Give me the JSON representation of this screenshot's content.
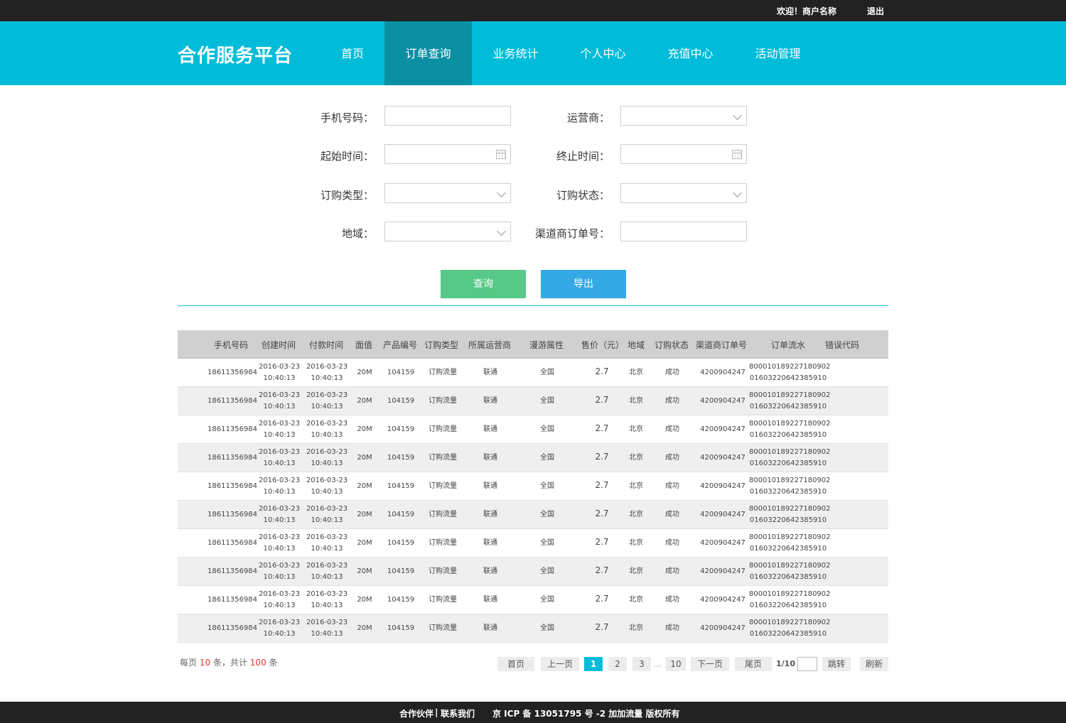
{
  "topbar": {
    "welcome": "欢迎！商户名称",
    "logout": "退出"
  },
  "header": {
    "brand": "合作服务平台",
    "nav": [
      {
        "label": "首页",
        "active": false
      },
      {
        "label": "订单查询",
        "active": true
      },
      {
        "label": "业务统计",
        "active": false
      },
      {
        "label": "个人中心",
        "active": false
      },
      {
        "label": "充值中心",
        "active": false
      },
      {
        "label": "活动管理",
        "active": false
      }
    ]
  },
  "form": {
    "phone_label": "手机号码：",
    "carrier_label": "运营商：",
    "start_label": "起始时间：",
    "end_label": "终止时间：",
    "order_type_label": "订购类型：",
    "order_status_label": "订购状态：",
    "region_label": "地域：",
    "channel_order_label": "渠道商订单号："
  },
  "actions": {
    "query": "查询",
    "export": "导出"
  },
  "table": {
    "headers": [
      "手机号码",
      "创建时间",
      "付款时间",
      "面值",
      "产品编号",
      "订购类型",
      "所属运营商",
      "漫游属性",
      "售价（元）",
      "地域",
      "订购状态",
      "渠道商订单号",
      "订单流水",
      "错误代码"
    ],
    "rows": [
      {
        "phone": "18611356984",
        "created_date": "2016-03-23",
        "created_time": "10:40:13",
        "paid_date": "2016-03-23",
        "paid_time": "10:40:13",
        "face": "20M",
        "product": "104159",
        "type": "订购流量",
        "carrier": "联通",
        "roam": "全国",
        "price": "2.7",
        "region": "北京",
        "status": "成功",
        "channel_order": "4200904247",
        "serial_1": "800010189227180902",
        "serial_2": "01603220642385910",
        "error": ""
      },
      {
        "phone": "18611356984",
        "created_date": "2016-03-23",
        "created_time": "10:40:13",
        "paid_date": "2016-03-23",
        "paid_time": "10:40:13",
        "face": "20M",
        "product": "104159",
        "type": "订购流量",
        "carrier": "联通",
        "roam": "全国",
        "price": "2.7",
        "region": "北京",
        "status": "成功",
        "channel_order": "4200904247",
        "serial_1": "800010189227180902",
        "serial_2": "01603220642385910",
        "error": ""
      },
      {
        "phone": "18611356984",
        "created_date": "2016-03-23",
        "created_time": "10:40:13",
        "paid_date": "2016-03-23",
        "paid_time": "10:40:13",
        "face": "20M",
        "product": "104159",
        "type": "订购流量",
        "carrier": "联通",
        "roam": "全国",
        "price": "2.7",
        "region": "北京",
        "status": "成功",
        "channel_order": "4200904247",
        "serial_1": "800010189227180902",
        "serial_2": "01603220642385910",
        "error": ""
      },
      {
        "phone": "18611356984",
        "created_date": "2016-03-23",
        "created_time": "10:40:13",
        "paid_date": "2016-03-23",
        "paid_time": "10:40:13",
        "face": "20M",
        "product": "104159",
        "type": "订购流量",
        "carrier": "联通",
        "roam": "全国",
        "price": "2.7",
        "region": "北京",
        "status": "成功",
        "channel_order": "4200904247",
        "serial_1": "800010189227180902",
        "serial_2": "01603220642385910",
        "error": ""
      },
      {
        "phone": "18611356984",
        "created_date": "2016-03-23",
        "created_time": "10:40:13",
        "paid_date": "2016-03-23",
        "paid_time": "10:40:13",
        "face": "20M",
        "product": "104159",
        "type": "订购流量",
        "carrier": "联通",
        "roam": "全国",
        "price": "2.7",
        "region": "北京",
        "status": "成功",
        "channel_order": "4200904247",
        "serial_1": "800010189227180902",
        "serial_2": "01603220642385910",
        "error": ""
      },
      {
        "phone": "18611356984",
        "created_date": "2016-03-23",
        "created_time": "10:40:13",
        "paid_date": "2016-03-23",
        "paid_time": "10:40:13",
        "face": "20M",
        "product": "104159",
        "type": "订购流量",
        "carrier": "联通",
        "roam": "全国",
        "price": "2.7",
        "region": "北京",
        "status": "成功",
        "channel_order": "4200904247",
        "serial_1": "800010189227180902",
        "serial_2": "01603220642385910",
        "error": ""
      },
      {
        "phone": "18611356984",
        "created_date": "2016-03-23",
        "created_time": "10:40:13",
        "paid_date": "2016-03-23",
        "paid_time": "10:40:13",
        "face": "20M",
        "product": "104159",
        "type": "订购流量",
        "carrier": "联通",
        "roam": "全国",
        "price": "2.7",
        "region": "北京",
        "status": "成功",
        "channel_order": "4200904247",
        "serial_1": "800010189227180902",
        "serial_2": "01603220642385910",
        "error": ""
      },
      {
        "phone": "18611356984",
        "created_date": "2016-03-23",
        "created_time": "10:40:13",
        "paid_date": "2016-03-23",
        "paid_time": "10:40:13",
        "face": "20M",
        "product": "104159",
        "type": "订购流量",
        "carrier": "联通",
        "roam": "全国",
        "price": "2.7",
        "region": "北京",
        "status": "成功",
        "channel_order": "4200904247",
        "serial_1": "800010189227180902",
        "serial_2": "01603220642385910",
        "error": ""
      },
      {
        "phone": "18611356984",
        "created_date": "2016-03-23",
        "created_time": "10:40:13",
        "paid_date": "2016-03-23",
        "paid_time": "10:40:13",
        "face": "20M",
        "product": "104159",
        "type": "订购流量",
        "carrier": "联通",
        "roam": "全国",
        "price": "2.7",
        "region": "北京",
        "status": "成功",
        "channel_order": "4200904247",
        "serial_1": "800010189227180902",
        "serial_2": "01603220642385910",
        "error": ""
      },
      {
        "phone": "18611356984",
        "created_date": "2016-03-23",
        "created_time": "10:40:13",
        "paid_date": "2016-03-23",
        "paid_time": "10:40:13",
        "face": "20M",
        "product": "104159",
        "type": "订购流量",
        "carrier": "联通",
        "roam": "全国",
        "price": "2.7",
        "region": "北京",
        "status": "成功",
        "channel_order": "4200904247",
        "serial_1": "800010189227180902",
        "serial_2": "01603220642385910",
        "error": ""
      }
    ]
  },
  "summary": {
    "prefix": "每页",
    "per_page": "10",
    "mid": "条，共计",
    "total": "100",
    "suffix": "条"
  },
  "pagination": {
    "first": "首页",
    "prev": "上一页",
    "pages": [
      "1",
      "2",
      "3"
    ],
    "ellipsis": "...",
    "last_page": "10",
    "next": "下一页",
    "last": "尾页",
    "info": "1/10",
    "jump": "跳转",
    "refresh": "刷新",
    "current": "1"
  },
  "footer": {
    "partners": "合作伙伴",
    "separator": "|",
    "contact": "联系我们",
    "icp": "京 ICP 备 13051795 号 -2 加加流量  版权所有"
  },
  "colors": {
    "header": "#00bcd9",
    "nav_active": "#0a8fa3",
    "query_btn": "#56c989",
    "export_btn": "#35a8e6",
    "topbar": "#222222"
  }
}
